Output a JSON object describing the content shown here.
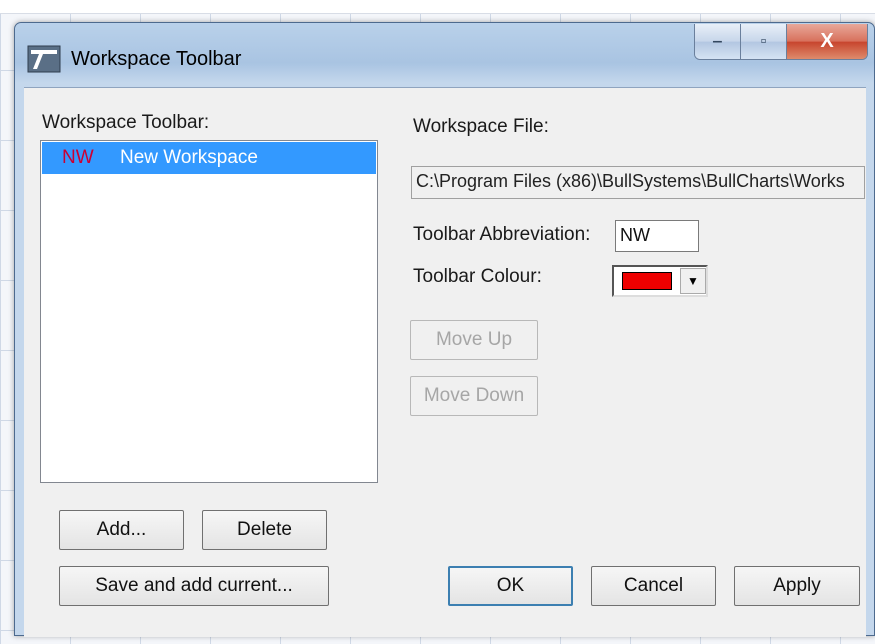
{
  "window": {
    "title": "Workspace Toolbar",
    "minimize_glyph": "‒",
    "maximize_glyph": "▫",
    "close_glyph": "X"
  },
  "left": {
    "label": "Workspace Toolbar:",
    "items": [
      {
        "abbr": "NW",
        "name": "New Workspace",
        "selected": true
      }
    ],
    "add_label": "Add...",
    "delete_label": "Delete",
    "save_add_label": "Save and add current..."
  },
  "right": {
    "file_label": "Workspace File:",
    "file_value": "C:\\Program Files (x86)\\BullSystems\\BullCharts\\Works",
    "abbr_label": "Toolbar Abbreviation:",
    "abbr_value": "NW",
    "colour_label": "Toolbar Colour:",
    "colour_value": "#ee0000",
    "move_up_label": "Move Up",
    "move_down_label": "Move Down"
  },
  "footer": {
    "ok_label": "OK",
    "cancel_label": "Cancel",
    "apply_label": "Apply"
  },
  "colors": {
    "selection": "#3399ff",
    "abbr_text": "#cc0033",
    "titlebar": "#b9d1ea"
  }
}
